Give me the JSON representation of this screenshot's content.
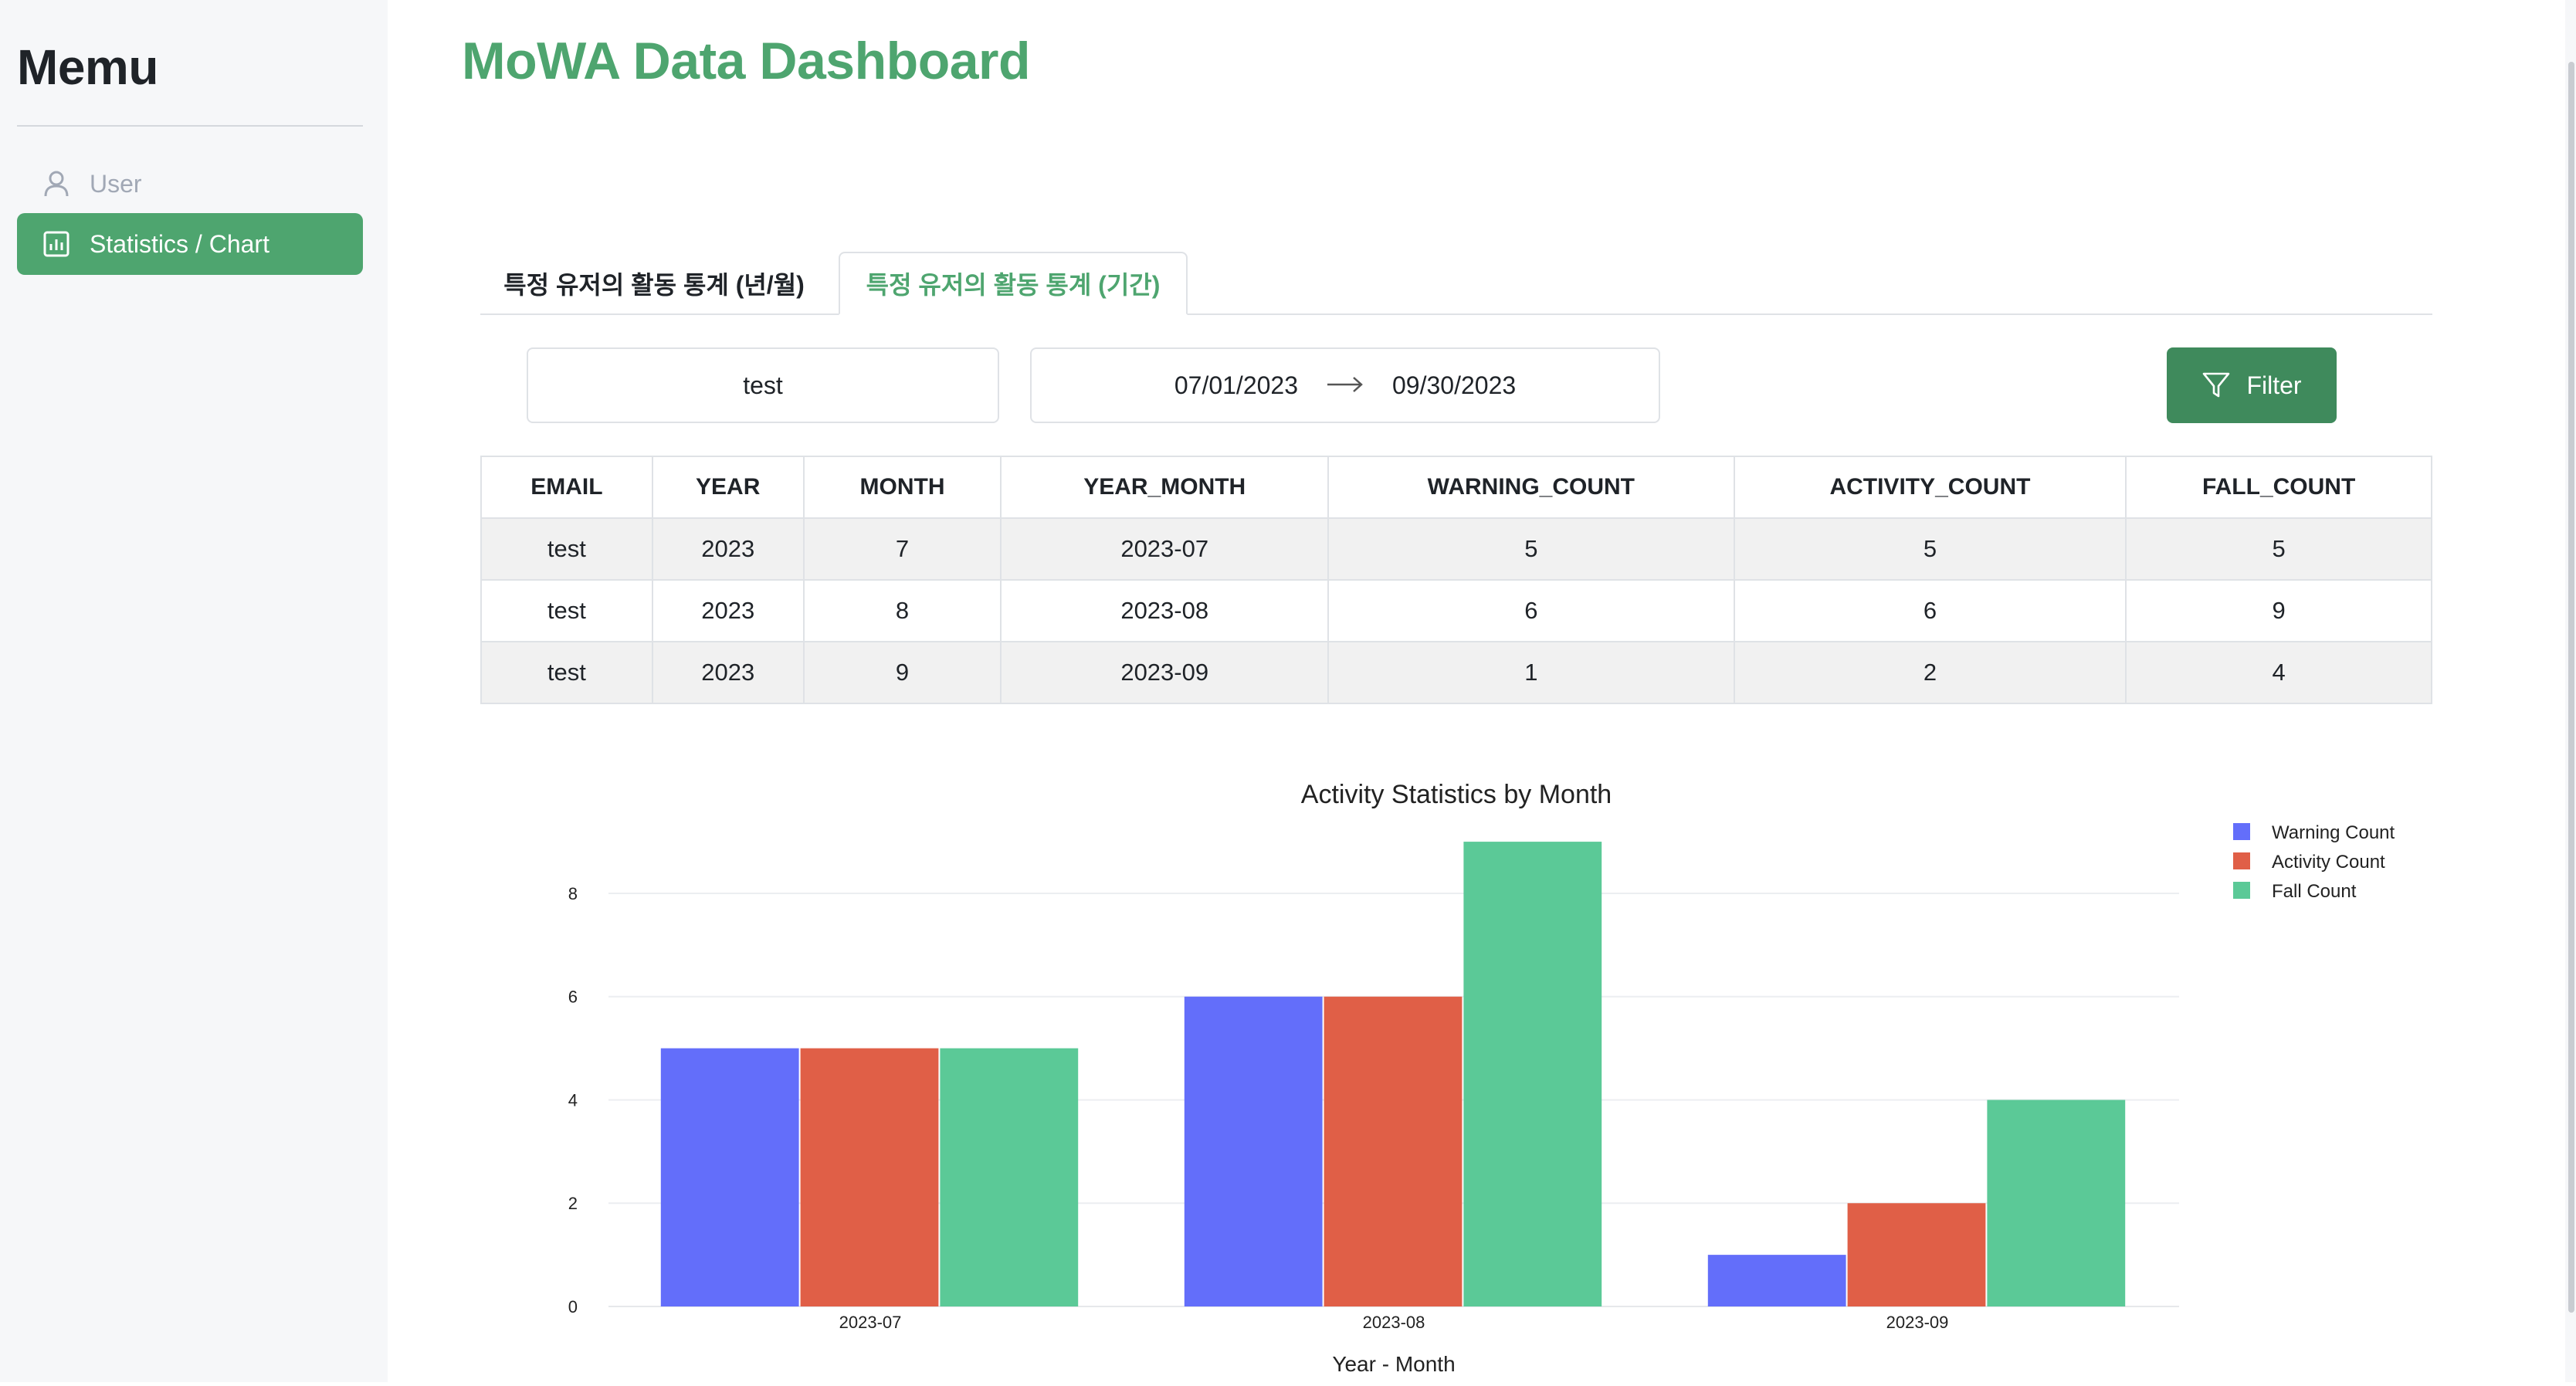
{
  "sidebar": {
    "title": "Memu",
    "items": [
      {
        "label": "User",
        "icon": "user-icon",
        "active": false
      },
      {
        "label": "Statistics / Chart",
        "icon": "bar-chart-icon",
        "active": true
      }
    ]
  },
  "header": {
    "title": "MoWA Data Dashboard"
  },
  "tabs": [
    {
      "label": "특정 유저의 활동 통계 (년/월)",
      "active": false
    },
    {
      "label": "특정 유저의 활동 통계 (기간)",
      "active": true
    }
  ],
  "filters": {
    "user_value": "test",
    "date_start": "07/01/2023",
    "date_end": "09/30/2023",
    "filter_label": "Filter"
  },
  "table": {
    "headers": [
      "EMAIL",
      "YEAR",
      "MONTH",
      "YEAR_MONTH",
      "WARNING_COUNT",
      "ACTIVITY_COUNT",
      "FALL_COUNT"
    ],
    "rows": [
      [
        "test",
        "2023",
        "7",
        "2023-07",
        "5",
        "5",
        "5"
      ],
      [
        "test",
        "2023",
        "8",
        "2023-08",
        "6",
        "6",
        "9"
      ],
      [
        "test",
        "2023",
        "9",
        "2023-09",
        "1",
        "2",
        "4"
      ]
    ]
  },
  "colors": {
    "accent": "#4ea56f",
    "filter_button": "#3f8a5c",
    "warning": "#636efa",
    "activity": "#ef553b",
    "fall": "#00cc96"
  },
  "chart_data": {
    "type": "bar",
    "title": "Activity Statistics by Month",
    "xlabel": "Year - Month",
    "ylabel": "",
    "categories": [
      "2023-07",
      "2023-08",
      "2023-09"
    ],
    "series": [
      {
        "name": "Warning Count",
        "values": [
          5,
          6,
          1
        ],
        "color": "#636efa"
      },
      {
        "name": "Activity Count",
        "values": [
          5,
          6,
          2
        ],
        "color": "#e05f47"
      },
      {
        "name": "Fall Count",
        "values": [
          5,
          9,
          4
        ],
        "color": "#5bc997"
      }
    ],
    "ylim": [
      0,
      9.45
    ],
    "yticks": [
      0,
      2,
      4,
      6,
      8
    ],
    "grid": true,
    "legend": "top-right"
  }
}
